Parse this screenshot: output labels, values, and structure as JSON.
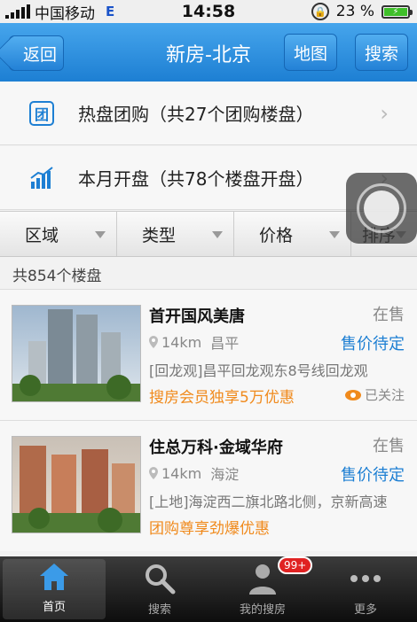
{
  "status_bar": {
    "carrier": "中国移动",
    "network": "E",
    "time": "14:58",
    "battery": "23 %"
  },
  "nav": {
    "back_label": "返回",
    "title": "新房-北京",
    "map_label": "地图",
    "search_label": "搜索"
  },
  "features": [
    {
      "icon": "tuan-icon",
      "text": "热盘团购（共27个团购楼盘）"
    },
    {
      "icon": "chart-icon",
      "text": "本月开盘（共78个楼盘开盘）"
    }
  ],
  "filters": [
    {
      "label": "区域"
    },
    {
      "label": "类型"
    },
    {
      "label": "价格"
    },
    {
      "label": "排序"
    }
  ],
  "count_text": "共854个楼盘",
  "listings": [
    {
      "name": "首开国风美唐",
      "status": "在售",
      "distance": "14km",
      "district": "昌平",
      "price": "售价待定",
      "address": "[回龙观]昌平回龙观东8号线回龙观",
      "promo": "搜房会员独享5万优惠",
      "follow": "已关注"
    },
    {
      "name": "住总万科·金域华府",
      "status": "在售",
      "distance": "14km",
      "district": "海淀",
      "price": "售价待定",
      "address": "[上地]海淀西二旗北路北侧，京新高速",
      "promo": "团购尊享劲爆优惠",
      "follow": ""
    }
  ],
  "tabs": [
    {
      "label": "首页",
      "icon": "home-icon"
    },
    {
      "label": "搜索",
      "icon": "search-icon"
    },
    {
      "label": "我的搜房",
      "icon": "user-icon",
      "badge": "99+"
    },
    {
      "label": "更多",
      "icon": "more-icon"
    }
  ],
  "colors": {
    "nav_blue": "#1d7fd3",
    "price_blue": "#1d7fd3",
    "promo_orange": "#f08a1c",
    "badge_red": "#e02222"
  }
}
